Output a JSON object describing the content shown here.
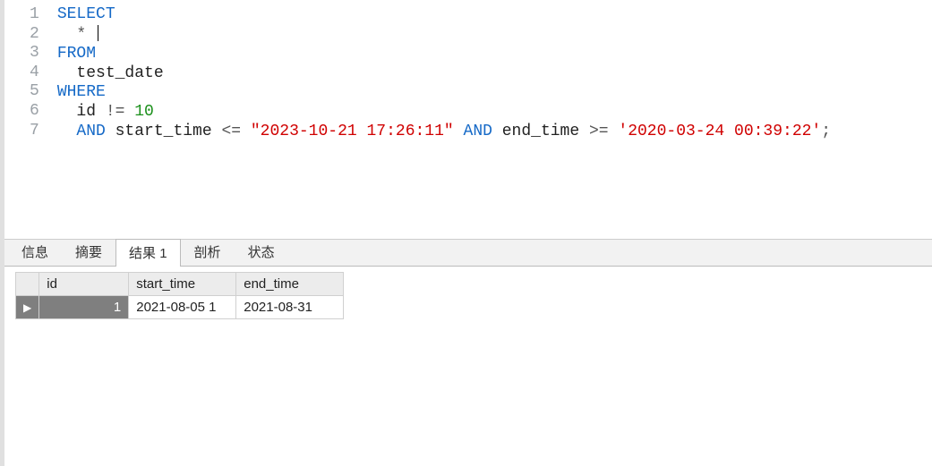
{
  "editor": {
    "lines": [
      [
        {
          "t": "SELECT",
          "c": "kw"
        }
      ],
      [
        {
          "t": "  ",
          "c": "txt"
        },
        {
          "t": "*",
          "c": "punct"
        },
        {
          "t": " ",
          "c": "txt"
        },
        {
          "t": "[CURSOR]",
          "c": "cursor"
        }
      ],
      [
        {
          "t": "FROM",
          "c": "kw"
        }
      ],
      [
        {
          "t": "  test_date",
          "c": "txt"
        }
      ],
      [
        {
          "t": "WHERE",
          "c": "kw"
        }
      ],
      [
        {
          "t": "  id ",
          "c": "txt"
        },
        {
          "t": "!=",
          "c": "punct"
        },
        {
          "t": " ",
          "c": "txt"
        },
        {
          "t": "10",
          "c": "num"
        }
      ],
      [
        {
          "t": "  ",
          "c": "txt"
        },
        {
          "t": "AND",
          "c": "kw"
        },
        {
          "t": " start_time ",
          "c": "txt"
        },
        {
          "t": "<=",
          "c": "punct"
        },
        {
          "t": " ",
          "c": "txt"
        },
        {
          "t": "\"2023-10-21 17:26:11\"",
          "c": "dstr"
        },
        {
          "t": " ",
          "c": "txt"
        },
        {
          "t": "AND",
          "c": "kw"
        },
        {
          "t": " end_time ",
          "c": "txt"
        },
        {
          "t": ">=",
          "c": "punct"
        },
        {
          "t": " ",
          "c": "txt"
        },
        {
          "t": "'2020-03-24 00:39:22'",
          "c": "sstr"
        },
        {
          "t": ";",
          "c": "punct"
        }
      ]
    ],
    "line_numbers": [
      "1",
      "2",
      "3",
      "4",
      "5",
      "6",
      "7"
    ]
  },
  "tabs": {
    "items": [
      {
        "label": "信息",
        "active": false
      },
      {
        "label": "摘要",
        "active": false
      },
      {
        "label": "结果 1",
        "active": true
      },
      {
        "label": "剖析",
        "active": false
      },
      {
        "label": "状态",
        "active": false
      }
    ]
  },
  "results": {
    "columns": [
      "id",
      "start_time",
      "end_time"
    ],
    "rows": [
      {
        "pointer": "▶",
        "id": "1",
        "start_time": "2021-08-05 1",
        "end_time": "2021-08-31"
      }
    ]
  }
}
